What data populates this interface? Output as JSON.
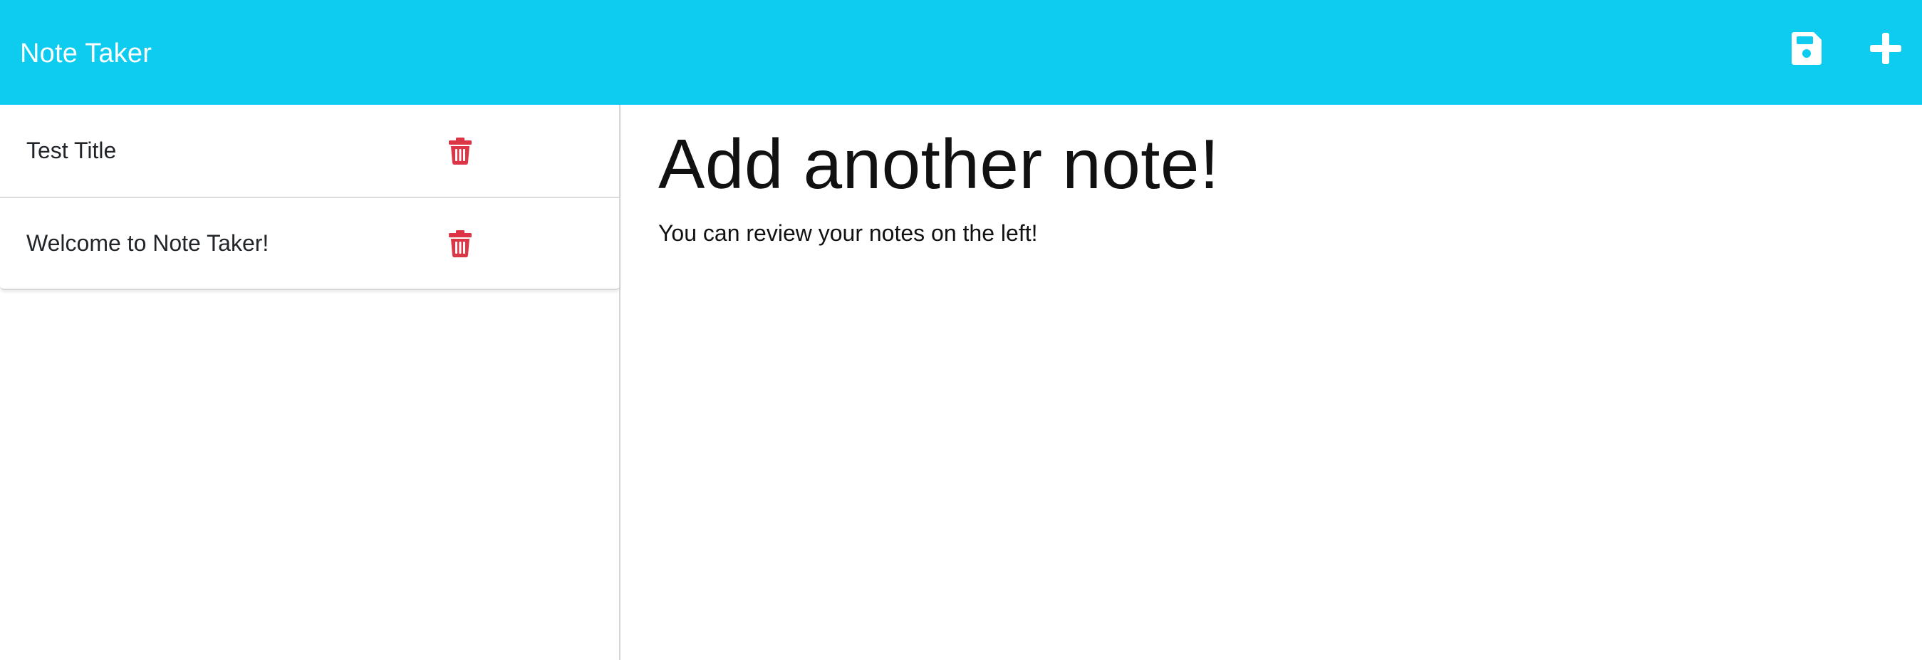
{
  "app": {
    "brand": "Note Taker",
    "accent_color": "#0ecbf0",
    "delete_color": "#dc3545"
  },
  "toolbar": {
    "save_icon": "save-icon",
    "new_note_icon": "plus-icon"
  },
  "sidebar": {
    "items": [
      {
        "title": "Test Title",
        "icon": "trash-icon"
      },
      {
        "title": "Welcome to Note Taker!",
        "icon": "trash-icon"
      }
    ]
  },
  "main": {
    "title": "Add another note!",
    "text": "You can review your notes on the left!"
  }
}
